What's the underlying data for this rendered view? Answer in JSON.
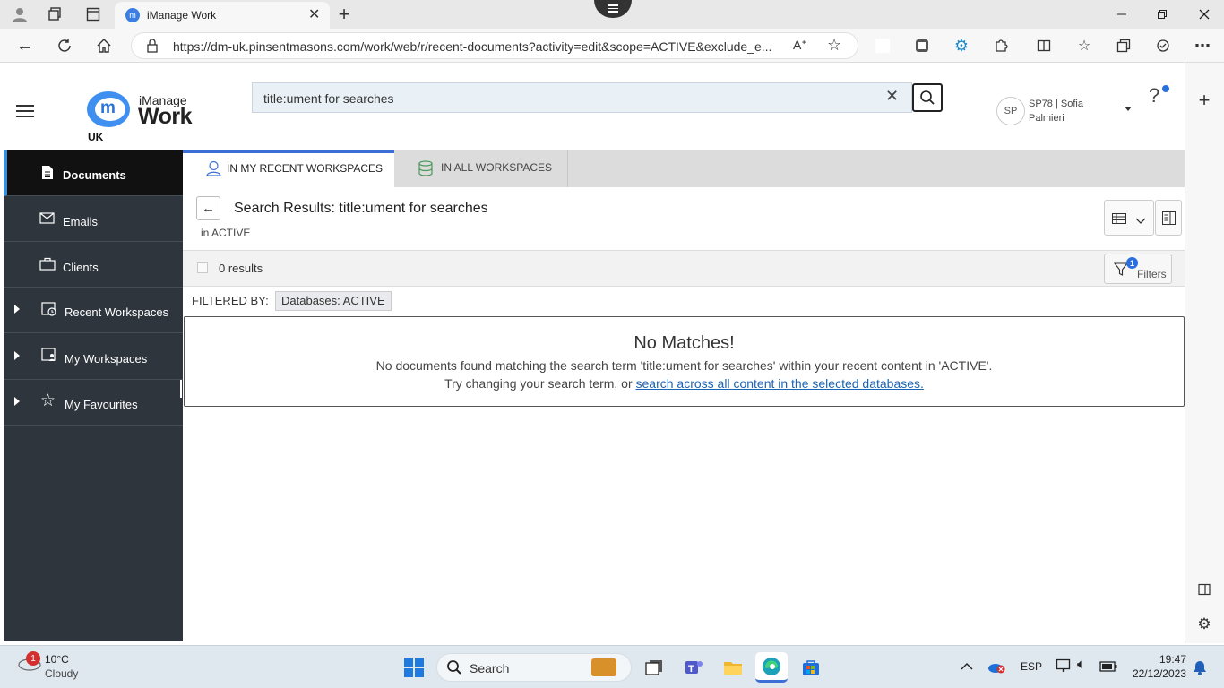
{
  "browser": {
    "tab_title": "iManage Work",
    "url": "https://dm-uk.pinsentmasons.com/work/web/r/recent-documents?activity=edit&scope=ACTIVE&exclude_e..."
  },
  "app": {
    "logo_brand": "iManage",
    "logo_product": "Work",
    "region": "UK",
    "search_value": "title:ument for searches",
    "user_initials": "SP",
    "user_name_line1": "SP78 | Sofia",
    "user_name_line2": "Palmieri",
    "help_label": "?"
  },
  "nav": {
    "items": [
      {
        "label": "Documents"
      },
      {
        "label": "Emails"
      },
      {
        "label": "Clients"
      },
      {
        "label": "Recent Workspaces"
      },
      {
        "label": "My Workspaces"
      },
      {
        "label": "My Favourites"
      }
    ]
  },
  "tabs": {
    "recent": "IN MY RECENT WORKSPACES",
    "all": "IN ALL WORKSPACES"
  },
  "results": {
    "heading": "Search Results: title:ument for searches",
    "scope": "in ACTIVE",
    "count": "0 results",
    "filters_label": "Filters",
    "filters_badge": "1",
    "filtered_by_label": "FILTERED BY:",
    "filter_chip": "Databases: ACTIVE",
    "no_match_title": "No Matches!",
    "no_match_line1": "No documents found matching the search term 'title:ument for searches' within your recent content in 'ACTIVE'.",
    "no_match_line2": "Try changing your search term, or",
    "no_match_link": "search across all content in the selected databases."
  },
  "taskbar": {
    "weather_temp": "10°C",
    "weather_desc": "Cloudy",
    "weather_badge": "1",
    "search_label": "Search",
    "lang": "ESP",
    "time": "19:47",
    "date": "22/12/2023"
  },
  "colors": {
    "nav_bg": "#2e353d",
    "accent": "#3b6fd6",
    "link": "#1a64b4"
  }
}
